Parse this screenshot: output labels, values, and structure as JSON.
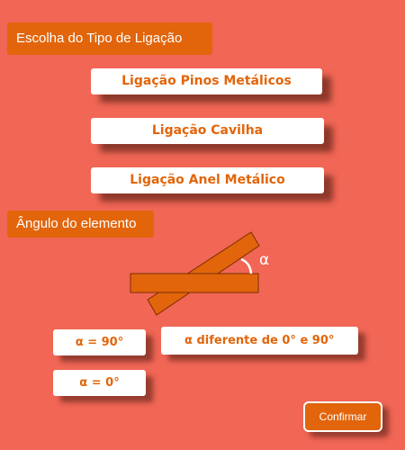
{
  "sections": {
    "connection_type_label": "Escolha do Tipo de Ligação",
    "angle_label": "Ângulo do elemento"
  },
  "connection_options": [
    {
      "label": "Ligação Pinos Metálicos"
    },
    {
      "label": "Ligação Cavilha"
    },
    {
      "label": "Ligação Anel Metálico"
    }
  ],
  "angle_figure": {
    "symbol": "α"
  },
  "angle_options": {
    "ninety": "α = 90°",
    "different": "α diferente de 0° e 90°",
    "zero": "α = 0°"
  },
  "confirm_label": "Confirmar",
  "colors": {
    "background": "#f16655",
    "accent": "#e2650b",
    "button_bg": "#ffffff"
  }
}
